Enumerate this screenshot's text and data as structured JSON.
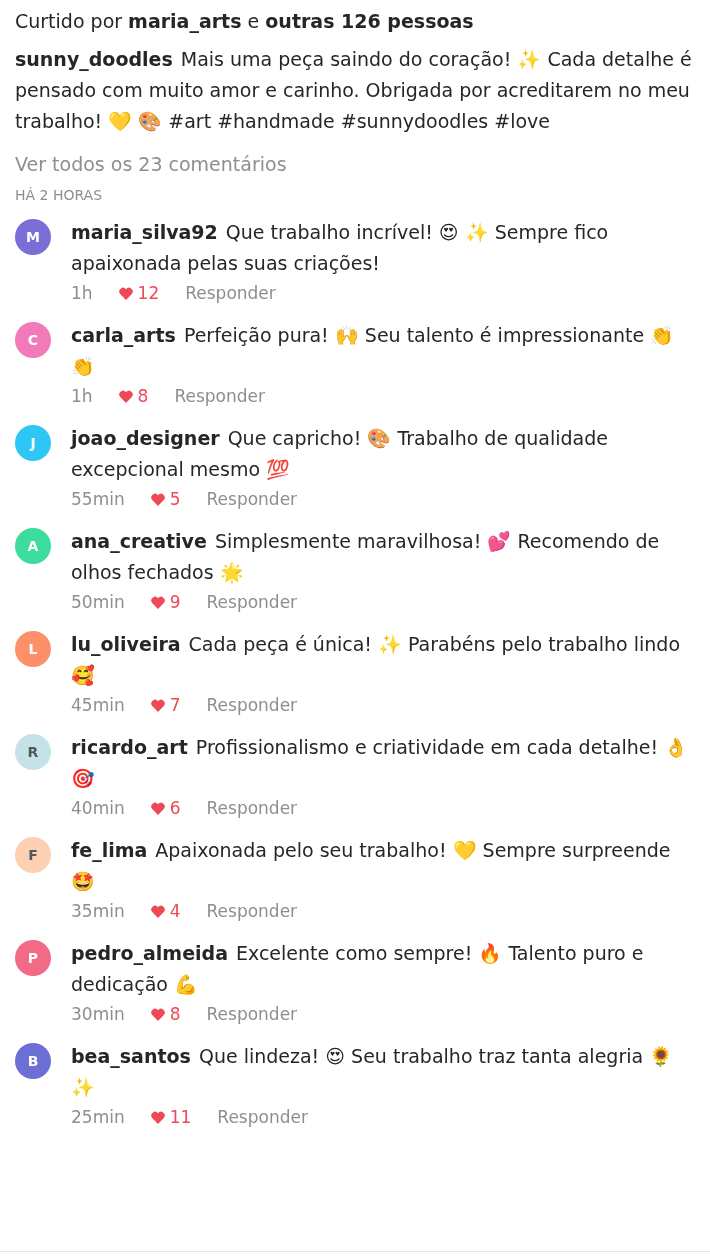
{
  "likes_line": "Curtido por **maria_arts** e **outras 126 pessoas**",
  "caption": {
    "username": "sunny_doodles",
    "text": "Mais uma peça saindo do coração! ✨ Cada detalhe é pensado com muito amor e carinho. Obrigada por acreditarem no meu trabalho! 💛 🎨 #art #handmade #sunnydoodles #love"
  },
  "view_all": "Ver todos os 23 comentários",
  "timestamp": "HÁ 2 HORAS",
  "comments": [
    {
      "initial": "M",
      "color": "#7a6fd6",
      "username": "maria_silva92",
      "text": "Que trabalho incrível! 😍 ✨ Sempre fico apaixonada pelas suas criações!",
      "time": "1h",
      "likes": "12",
      "reply": "Responder"
    },
    {
      "initial": "C",
      "color": "#f27ab8",
      "username": "carla_arts",
      "text": "Perfeição pura! 🙌 Seu talento é impressionante 👏 👏",
      "time": "1h",
      "likes": "8",
      "reply": "Responder"
    },
    {
      "initial": "J",
      "color": "#2ec7f5",
      "username": "joao_designer",
      "text": "Que capricho! 🎨 Trabalho de qualidade excepcional mesmo 💯",
      "time": "55min",
      "likes": "5",
      "reply": "Responder"
    },
    {
      "initial": "A",
      "color": "#3ddc9c",
      "username": "ana_creative",
      "text": "Simplesmente maravilhosa! 💕 Recomendo de olhos fechados 🌟",
      "time": "50min",
      "likes": "9",
      "reply": "Responder"
    },
    {
      "initial": "L",
      "color": "#fd9068",
      "username": "lu_oliveira",
      "text": "Cada peça é única! ✨ Parabéns pelo trabalho lindo 🥰",
      "time": "45min",
      "likes": "7",
      "reply": "Responder"
    },
    {
      "initial": "R",
      "color": "#c4e2e8",
      "username": "ricardo_art",
      "text": "Profissionalismo e criatividade em cada detalhe! 👌 🎯",
      "time": "40min",
      "likes": "6",
      "reply": "Responder"
    },
    {
      "initial": "F",
      "color": "#fdcfb3",
      "username": "fe_lima",
      "text": "Apaixonada pelo seu trabalho! 💛 Sempre surpreende 🤩",
      "time": "35min",
      "likes": "4",
      "reply": "Responder"
    },
    {
      "initial": "P",
      "color": "#f26a86",
      "username": "pedro_almeida",
      "text": "Excelente como sempre! 🔥 Talento puro e dedicação 💪",
      "time": "30min",
      "likes": "8",
      "reply": "Responder"
    },
    {
      "initial": "B",
      "color": "#6c6fd6",
      "username": "bea_santos",
      "text": "Que lindeza! 😍 Seu trabalho traz tanta alegria 🌻 ✨",
      "time": "25min",
      "likes": "11",
      "reply": "Responder"
    }
  ]
}
